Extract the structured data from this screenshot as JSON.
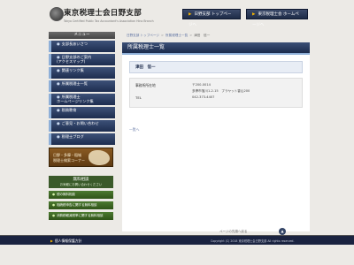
{
  "header": {
    "site_name": "東京税理士会日野支部",
    "site_subtitle": "Tokyo Certified Public Tax Accountant's Association Hino Branch",
    "btn_top": "日野支部 トップページへ",
    "btn_tokyo": "東京税理士会 ホームページへ"
  },
  "sidebar": {
    "menu_title": "メニュー",
    "items": [
      {
        "label": "支部長あいさつ"
      },
      {
        "label": "日野支部のご案内",
        "sub": "(アクセスマップ)"
      },
      {
        "label": "関連リンク集"
      },
      {
        "label": "所属税理士一覧"
      },
      {
        "label": "所属税理士",
        "sub": "ホームページリンク集"
      },
      {
        "label": "税務教育"
      },
      {
        "label": "ご意見・お問い合わせ"
      },
      {
        "label": "税理士ブログ"
      }
    ],
    "banner": {
      "line1": "日野・多摩・稲城",
      "line2": "税理士検索コーナー"
    },
    "consult": {
      "title": "無料相談",
      "subtitle": "お気軽にお問い合わせください",
      "items": [
        {
          "label": "税の無料相談"
        },
        {
          "label": "相続税申告に関する無料相談"
        },
        {
          "label": "消費税軽減税率に関する無料相談"
        }
      ]
    }
  },
  "main": {
    "breadcrumb": [
      "日野支部 トップページ",
      "所属税理士一覧",
      "津田　信一"
    ],
    "page_title": "所属税理士一覧",
    "person_name": "津田　信一",
    "office": {
      "label_office": "事務所所在地",
      "postal": "〒200-0014",
      "address": "多摩市落川1-2-15　ブラヤット香山200",
      "label_tel": "TEL",
      "tel": "042-373-4407"
    },
    "back_link": "一覧へ"
  },
  "page_top": "ページの先頭へ戻る",
  "footer": {
    "link": "個人情報保護方針",
    "copyright": "Copyright (C) 2018 東京税理士会日野支部 All rights reserved."
  }
}
